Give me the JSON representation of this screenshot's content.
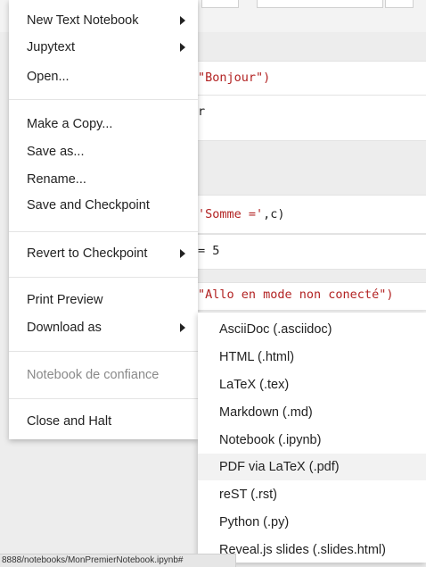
{
  "cells": {
    "line1": "\"Bonjour\")",
    "line2": "r",
    "line3_str": "'Somme ='",
    "line3_rest": ",c)",
    "line4": "= 5",
    "line5": "\"Allo en mode non conecté\")"
  },
  "file_menu": {
    "items": [
      {
        "label": "New Text Notebook",
        "submenu": true
      },
      {
        "label": "Jupytext",
        "submenu": true
      },
      {
        "label": "Open..."
      },
      {
        "label": "Make a Copy..."
      },
      {
        "label": "Save as..."
      },
      {
        "label": "Rename..."
      },
      {
        "label": "Save and Checkpoint"
      },
      {
        "label": "Revert to Checkpoint",
        "submenu": true
      },
      {
        "label": "Print Preview"
      },
      {
        "label": "Download as",
        "submenu": true
      },
      {
        "label": "Notebook de confiance",
        "disabled": true
      },
      {
        "label": "Close and Halt"
      }
    ]
  },
  "download_submenu": {
    "items": [
      "AsciiDoc (.asciidoc)",
      "HTML (.html)",
      "LaTeX (.tex)",
      "Markdown (.md)",
      "Notebook (.ipynb)",
      "PDF via LaTeX (.pdf)",
      "reST (.rst)",
      "Python (.py)",
      "Reveal.js slides (.slides.html)"
    ],
    "highlighted": "PDF via LaTeX (.pdf)"
  },
  "status_url": "8888/notebooks/MonPremierNotebook.ipynb#"
}
